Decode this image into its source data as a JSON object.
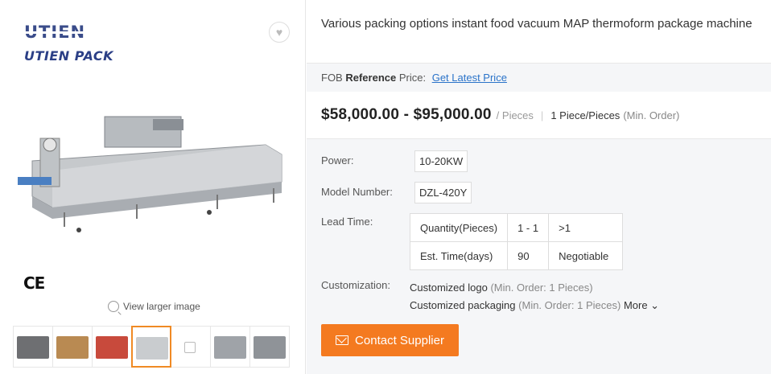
{
  "brand": {
    "mark": "UTIEN",
    "name": "UTIEN PACK"
  },
  "gallery": {
    "certification_mark": "CE",
    "view_larger_label": "View larger image",
    "thumbnails": [
      {
        "name": "thumbnail-1",
        "color": "#6e6f72"
      },
      {
        "name": "thumbnail-2",
        "color": "#b98a52"
      },
      {
        "name": "thumbnail-3",
        "color": "#c84a3c"
      },
      {
        "name": "thumbnail-4",
        "color": "#c9cccf"
      },
      {
        "name": "thumbnail-5",
        "color": "#ffffff"
      },
      {
        "name": "thumbnail-6",
        "color": "#9fa3a8"
      },
      {
        "name": "thumbnail-7",
        "color": "#8f9398"
      }
    ]
  },
  "product": {
    "title": "Various packing options instant food vacuum MAP thermoform package machine",
    "fob_prefix": "FOB",
    "fob_bold": "Reference",
    "fob_suffix": "Price:",
    "fob_link": "Get Latest Price",
    "price_range": "$58,000.00 - $95,000.00",
    "price_unit": "/ Pieces",
    "separator": "|",
    "moq": "1 Piece/Pieces",
    "moq_note": "(Min. Order)"
  },
  "specs": {
    "power_label": "Power:",
    "power_value": "10-20KW",
    "model_label": "Model Number:",
    "model_value": "DZL-420Y",
    "lead_label": "Lead Time:",
    "lead_table": {
      "row1": [
        "Quantity(Pieces)",
        "1 - 1",
        ">1"
      ],
      "row2": [
        "Est. Time(days)",
        "90",
        "Negotiable"
      ]
    },
    "customization_label": "Customization:",
    "customization": [
      {
        "text": "Customized logo",
        "note": "(Min. Order: 1 Pieces)"
      },
      {
        "text": "Customized packaging",
        "note": "(Min. Order: 1 Pieces)"
      }
    ],
    "more_label": "More"
  },
  "actions": {
    "contact_label": "Contact Supplier"
  },
  "colors": {
    "accent": "#f47a20",
    "link": "#2a73c9",
    "brand_blue": "#2b3f86"
  }
}
